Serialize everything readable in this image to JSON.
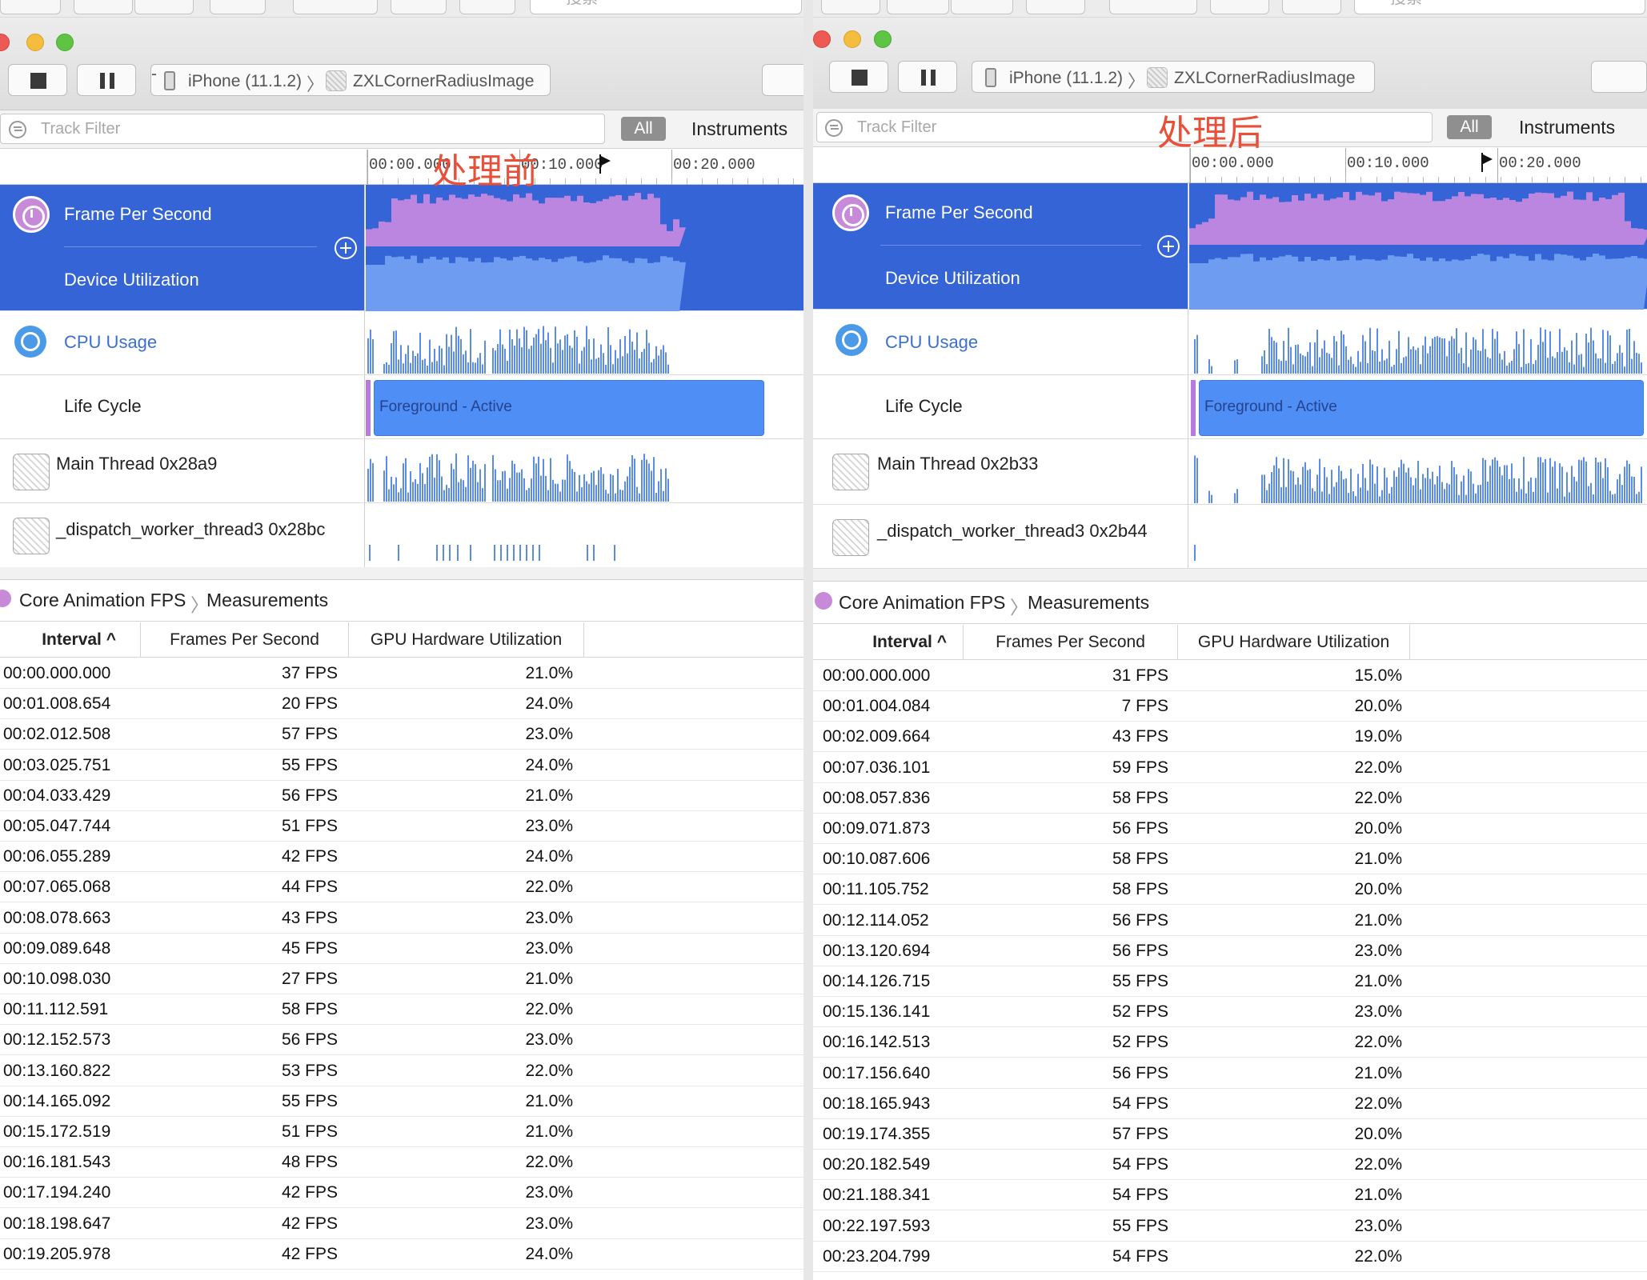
{
  "windows": [
    {
      "id": "left",
      "annotation": "处理前",
      "device": "iPhone (11.1.2)",
      "app": "ZXLCornerRadiusImage",
      "filter_placeholder": "Track Filter",
      "search_placeholder": "搜索",
      "all_label": "All",
      "instruments_label": "Instruments",
      "ruler_labels": [
        "00:00.000",
        "00:10.000",
        "00:20.000"
      ],
      "tracks": {
        "fps": "Frame Per Second",
        "device": "Device Utilization",
        "cpu": "CPU Usage",
        "lifecycle": "Life Cycle",
        "lifecycle_state": "Foreground - Active",
        "main_thread": "Main Thread  0x28a9",
        "worker": "_dispatch_worker_thread3  0x28bc"
      },
      "breadcrumb": [
        "Core Animation FPS",
        "Measurements"
      ],
      "columns": [
        "Interval",
        "Frames Per Second",
        "GPU Hardware Utilization"
      ],
      "rows": [
        [
          "00:00.000.000",
          "37 FPS",
          "21.0%"
        ],
        [
          "00:01.008.654",
          "20 FPS",
          "24.0%"
        ],
        [
          "00:02.012.508",
          "57 FPS",
          "23.0%"
        ],
        [
          "00:03.025.751",
          "55 FPS",
          "24.0%"
        ],
        [
          "00:04.033.429",
          "56 FPS",
          "21.0%"
        ],
        [
          "00:05.047.744",
          "51 FPS",
          "23.0%"
        ],
        [
          "00:06.055.289",
          "42 FPS",
          "24.0%"
        ],
        [
          "00:07.065.068",
          "44 FPS",
          "22.0%"
        ],
        [
          "00:08.078.663",
          "43 FPS",
          "23.0%"
        ],
        [
          "00:09.089.648",
          "45 FPS",
          "23.0%"
        ],
        [
          "00:10.098.030",
          "27 FPS",
          "21.0%"
        ],
        [
          "00:11.112.591",
          "58 FPS",
          "22.0%"
        ],
        [
          "00:12.152.573",
          "56 FPS",
          "23.0%"
        ],
        [
          "00:13.160.822",
          "53 FPS",
          "22.0%"
        ],
        [
          "00:14.165.092",
          "55 FPS",
          "21.0%"
        ],
        [
          "00:15.172.519",
          "51 FPS",
          "21.0%"
        ],
        [
          "00:16.181.543",
          "48 FPS",
          "22.0%"
        ],
        [
          "00:17.194.240",
          "42 FPS",
          "23.0%"
        ],
        [
          "00:18.198.647",
          "42 FPS",
          "23.0%"
        ],
        [
          "00:19.205.978",
          "42 FPS",
          "24.0%"
        ]
      ]
    },
    {
      "id": "right",
      "annotation": "处理后",
      "device": "iPhone (11.1.2)",
      "app": "ZXLCornerRadiusImage",
      "filter_placeholder": "Track Filter",
      "search_placeholder": "搜索",
      "all_label": "All",
      "instruments_label": "Instruments",
      "ruler_labels": [
        "00:00.000",
        "00:10.000",
        "00:20.000"
      ],
      "tracks": {
        "fps": "Frame Per Second",
        "device": "Device Utilization",
        "cpu": "CPU Usage",
        "lifecycle": "Life Cycle",
        "lifecycle_state": "Foreground - Active",
        "main_thread": "Main Thread  0x2b33",
        "worker": "_dispatch_worker_thread3  0x2b44"
      },
      "breadcrumb": [
        "Core Animation FPS",
        "Measurements"
      ],
      "columns": [
        "Interval",
        "Frames Per Second",
        "GPU Hardware Utilization"
      ],
      "rows": [
        [
          "00:00.000.000",
          "31 FPS",
          "15.0%"
        ],
        [
          "00:01.004.084",
          "7 FPS",
          "20.0%"
        ],
        [
          "00:02.009.664",
          "43 FPS",
          "19.0%"
        ],
        [
          "00:07.036.101",
          "59 FPS",
          "22.0%"
        ],
        [
          "00:08.057.836",
          "58 FPS",
          "22.0%"
        ],
        [
          "00:09.071.873",
          "56 FPS",
          "20.0%"
        ],
        [
          "00:10.087.606",
          "58 FPS",
          "21.0%"
        ],
        [
          "00:11.105.752",
          "58 FPS",
          "20.0%"
        ],
        [
          "00:12.114.052",
          "56 FPS",
          "21.0%"
        ],
        [
          "00:13.120.694",
          "56 FPS",
          "23.0%"
        ],
        [
          "00:14.126.715",
          "55 FPS",
          "21.0%"
        ],
        [
          "00:15.136.141",
          "52 FPS",
          "23.0%"
        ],
        [
          "00:16.142.513",
          "52 FPS",
          "22.0%"
        ],
        [
          "00:17.156.640",
          "56 FPS",
          "21.0%"
        ],
        [
          "00:18.165.943",
          "54 FPS",
          "22.0%"
        ],
        [
          "00:19.174.355",
          "57 FPS",
          "20.0%"
        ],
        [
          "00:20.182.549",
          "54 FPS",
          "22.0%"
        ],
        [
          "00:21.188.341",
          "54 FPS",
          "21.0%"
        ],
        [
          "00:22.197.593",
          "55 FPS",
          "23.0%"
        ],
        [
          "00:23.204.799",
          "54 FPS",
          "22.0%"
        ]
      ]
    }
  ],
  "colors": {
    "selected_track": "#3464d6",
    "fps_graph": "#bb86e0",
    "device_graph": "#6e9cf0",
    "cpu_graph": "#5b8de8",
    "lifecycle": "#4f8ef5",
    "annotation": "#e8503a"
  }
}
